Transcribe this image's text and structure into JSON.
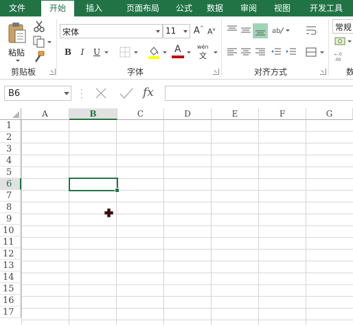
{
  "tabs": [
    "文件",
    "开始",
    "插入",
    "页面布局",
    "公式",
    "数据",
    "审阅",
    "视图",
    "开发工具"
  ],
  "clipboard": {
    "paste_label": "粘贴",
    "group_label": "剪贴板"
  },
  "font": {
    "name": "宋体",
    "size": "11",
    "group_label": "字体",
    "bold": "B",
    "italic": "I",
    "underline": "U",
    "phonetic": "wén"
  },
  "alignment": {
    "group_label": "对齐方式"
  },
  "number": {
    "format": "常规",
    "group_label": "数"
  },
  "formula_bar": {
    "name_box": "B6",
    "fx": "fx",
    "value": ""
  },
  "grid": {
    "columns": [
      "A",
      "B",
      "C",
      "D",
      "E",
      "F",
      "G"
    ],
    "rows": [
      "1",
      "2",
      "3",
      "4",
      "5",
      "6",
      "7",
      "8",
      "9",
      "10",
      "11",
      "12",
      "13",
      "14",
      "15",
      "16",
      "17"
    ],
    "selected_column": "B",
    "selected_row": "6",
    "active_cell": "B6"
  },
  "colors": {
    "accent": "#217346",
    "font_color": "#c00000",
    "highlight": "#ffff00"
  }
}
